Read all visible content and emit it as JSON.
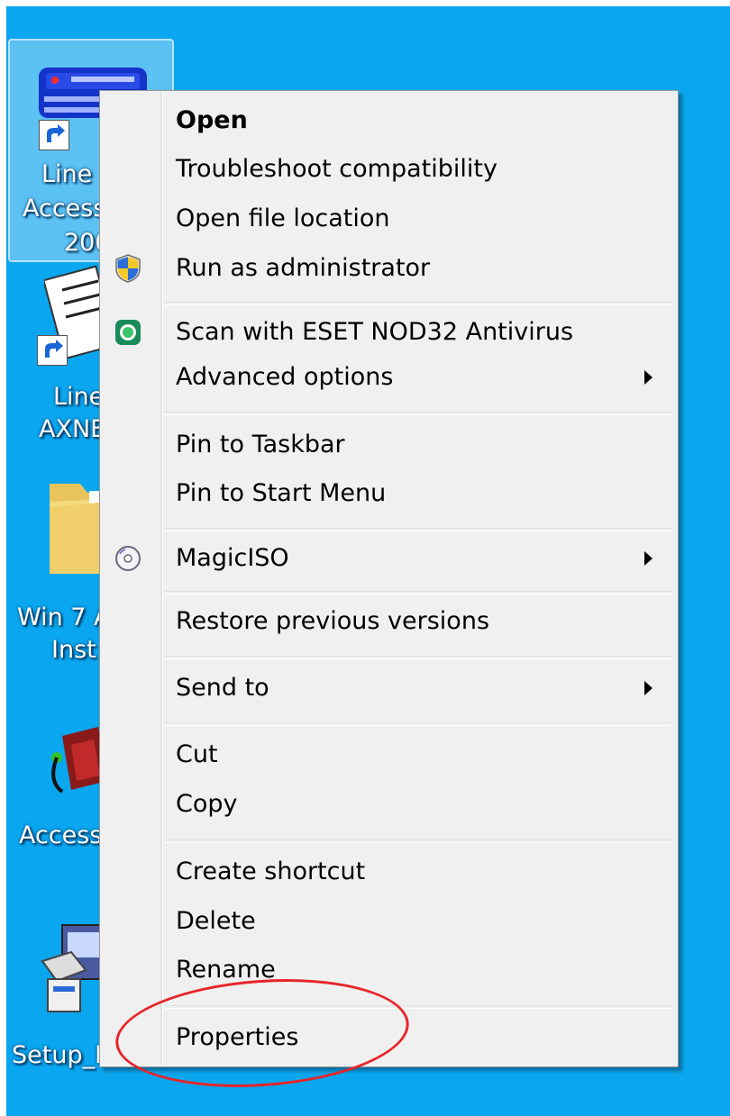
{
  "desktop": {
    "background": "#0aa6ef",
    "icons": [
      {
        "lines": [
          "Line",
          "Access",
          "200"
        ],
        "selected": true
      },
      {
        "lines": [
          "Line",
          "AXNE"
        ]
      },
      {
        "lines": [
          "Win 7 A",
          "Inst"
        ]
      },
      {
        "lines": [
          "Access"
        ]
      },
      {
        "lines": [
          "Setup_N"
        ]
      }
    ]
  },
  "menu": {
    "items": [
      {
        "label": "Open",
        "bold": true
      },
      {
        "label": "Troubleshoot compatibility"
      },
      {
        "label": "Open file location"
      },
      {
        "label": "Run as administrator",
        "icon": "uac-shield-icon"
      },
      {
        "label": "Scan with ESET NOD32 Antivirus",
        "icon": "eset-icon"
      },
      {
        "label": "Advanced options",
        "submenu": true
      },
      {
        "label": "Pin to Taskbar"
      },
      {
        "label": "Pin to Start Menu"
      },
      {
        "label": "MagicISO",
        "icon": "disc-icon",
        "submenu": true
      },
      {
        "label": "Restore previous versions"
      },
      {
        "label": "Send to",
        "submenu": true
      },
      {
        "label": "Cut"
      },
      {
        "label": "Copy"
      },
      {
        "label": "Create shortcut"
      },
      {
        "label": "Delete"
      },
      {
        "label": "Rename"
      },
      {
        "label": "Properties",
        "highlighted_annotation": true
      }
    ]
  },
  "annotation": {
    "color": "#e8242a",
    "target": "Properties"
  }
}
